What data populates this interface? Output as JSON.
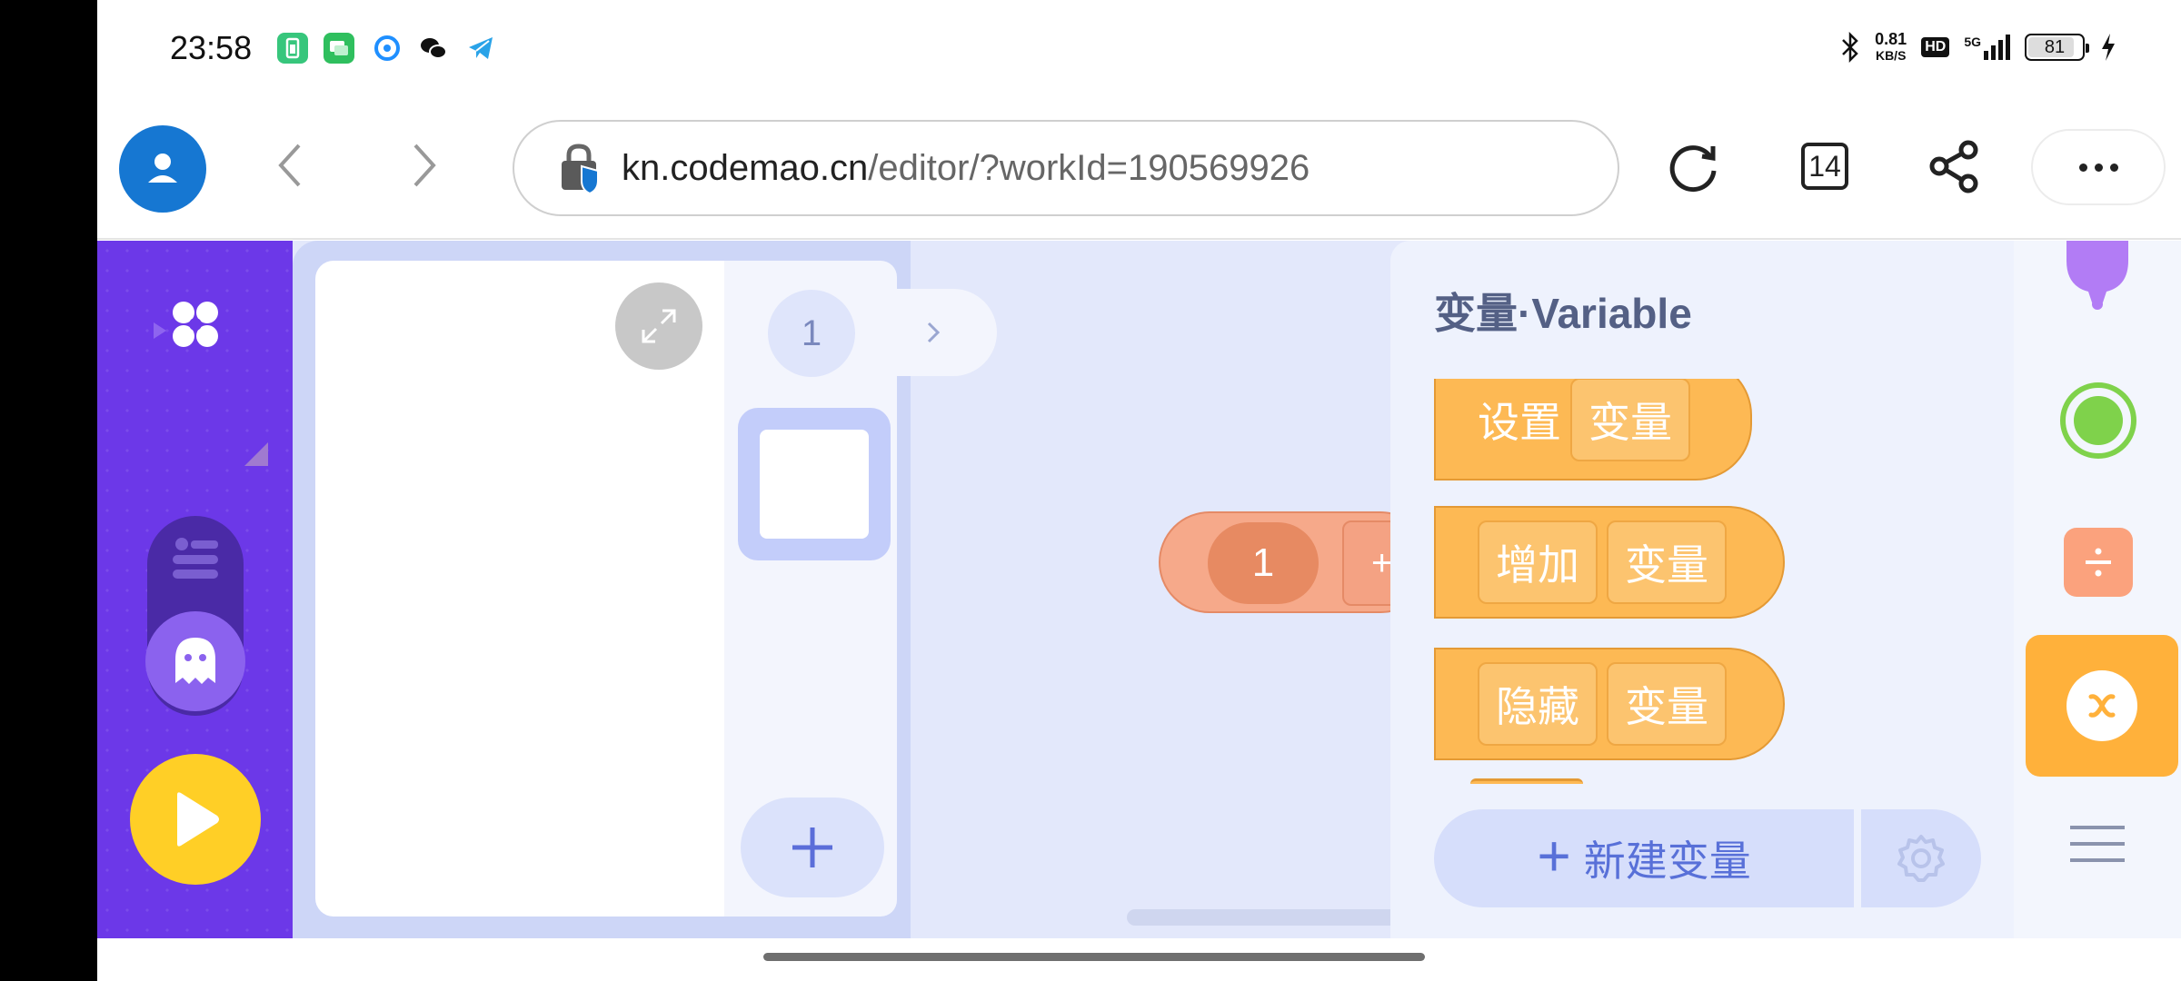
{
  "status_bar": {
    "time": "23:58",
    "net_speed_value": "0.81",
    "net_speed_unit": "KB/S",
    "hd_label": "HD",
    "signal_label": "5G",
    "battery_level": "81"
  },
  "browser": {
    "url_domain": "kn.codemao.cn",
    "url_path": "/editor/?workId=190569926",
    "tab_count": "14"
  },
  "stage": {
    "scene_number": "1"
  },
  "canvas": {
    "block_value": "1",
    "block_op": "+"
  },
  "drawer": {
    "title": "变量·Variable",
    "blocks": [
      {
        "label": "设置",
        "chip": "变量"
      },
      {
        "label_chip": "增加",
        "chip": "变量"
      },
      {
        "label_chip": "隐藏",
        "chip": "变量"
      }
    ],
    "new_variable_label": "新建变量"
  },
  "colors": {
    "rail_purple": "#6c38e8",
    "play_yellow": "#ffcf26",
    "variable_orange": "#fdb954",
    "active_category": "#ffb13b"
  }
}
